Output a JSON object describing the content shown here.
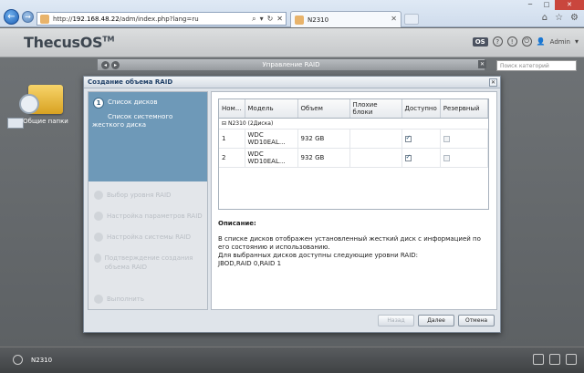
{
  "browser": {
    "url_prefix": "http://",
    "url_host": "192.168.48.22",
    "url_path": "/adm/index.php?lang=ru",
    "tab_title": "N2310",
    "addr_icons": [
      "⌕",
      "▾",
      "↻",
      "✕"
    ],
    "window_controls": [
      "─",
      "□",
      "✕"
    ],
    "toolbar_icons": [
      "⌂",
      "☆",
      "⚙"
    ]
  },
  "header": {
    "logo": "ThecusOS",
    "logo_tm": "TM",
    "os_badge": "OS",
    "help": "?",
    "info": "!",
    "user": "Admin"
  },
  "desktop": {
    "shared_folders": "Общие папки"
  },
  "bg_window": {
    "title": "Управление RAID",
    "search_placeholder": "Поиск категорий"
  },
  "dialog": {
    "title": "Создание объема RAID",
    "steps": {
      "active_num": "1",
      "active_label": "Список дисков",
      "active_sub": "Список системного жесткого диска",
      "s2": "Выбор уровня RAID",
      "s3": "Настройка параметров RAID",
      "s4": "Настройка системы RAID",
      "s5": "Подтверждение создания объема RAID",
      "s6": "Выполнить"
    },
    "table": {
      "headers": [
        "Ном...",
        "Модель",
        "Объем",
        "Плохие блоки",
        "Доступно",
        "Резервный"
      ],
      "group": "N2310 (2Диска)",
      "rows": [
        {
          "num": "1",
          "model": "WDC WD10EAL...",
          "size": "932 GB",
          "bad": "",
          "available": true,
          "spare": false
        },
        {
          "num": "2",
          "model": "WDC WD10EAL...",
          "size": "932 GB",
          "bad": "",
          "available": true,
          "spare": false
        }
      ]
    },
    "description": {
      "heading": "Описание:",
      "line1": "В списке дисков отображен установленный жесткий диск с информацией по его состоянию и использованию.",
      "line2": "Для выбранных дисков доступны следующие уровни RAID:",
      "line3": "JBOD,RAID 0,RAID 1"
    },
    "buttons": {
      "back": "Назад",
      "next": "Далее",
      "cancel": "Отмена"
    }
  },
  "taskbar": {
    "device": "N2310"
  },
  "colors": {
    "wizard_active": "#6e99b8",
    "dialog_title": "#1f3f66",
    "folder": "#f7d46a"
  }
}
